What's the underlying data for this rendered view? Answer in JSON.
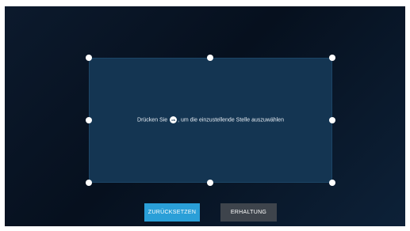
{
  "crop": {
    "instruction_before": "Drücken Sie",
    "ok_icon_label": "ok",
    "instruction_after": ", um die einzustellende Stelle auszuwählen"
  },
  "buttons": {
    "reset_label": "ZURÜCKSETZEN",
    "keep_label": "ERHALTUNG"
  },
  "colors": {
    "primary_button": "#2a9fd8",
    "secondary_button": "#3e444c",
    "crop_area": "#143552"
  }
}
